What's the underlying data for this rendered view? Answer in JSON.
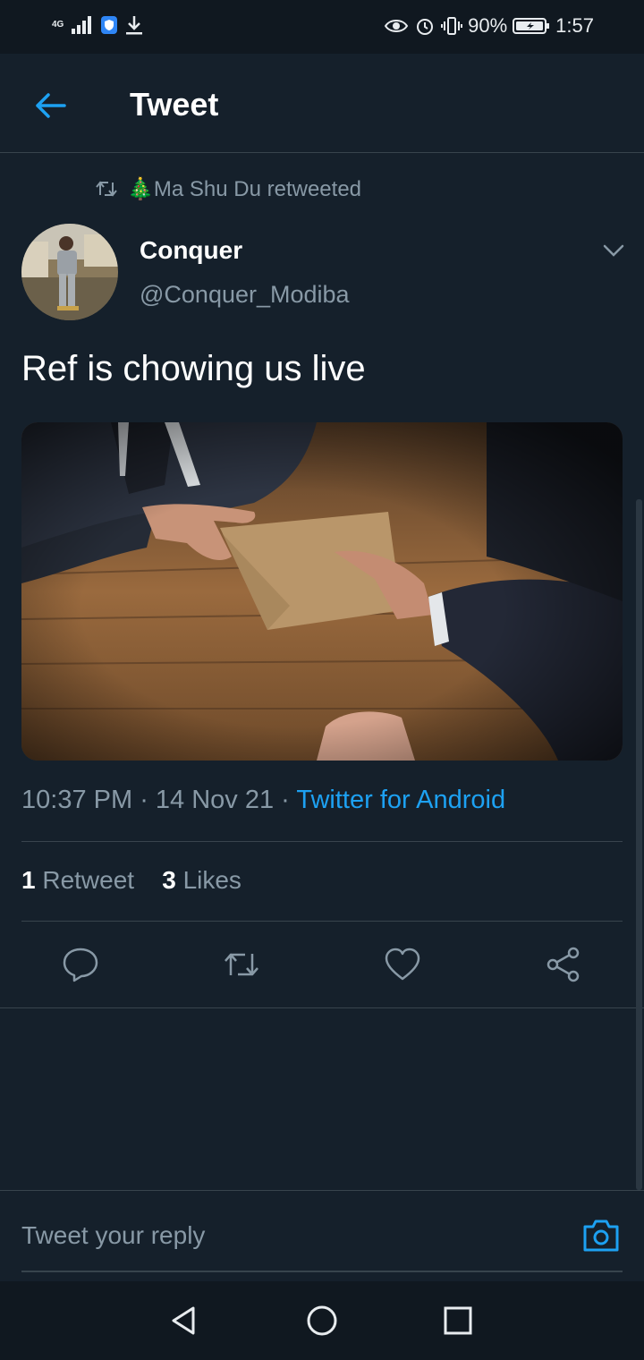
{
  "status_bar": {
    "network": "4G",
    "battery": "90%",
    "time": "1:57"
  },
  "header": {
    "title": "Tweet"
  },
  "retweet": {
    "emoji": "🎄",
    "text": "Ma Shu Du retweeted"
  },
  "tweet": {
    "display_name": "Conquer",
    "handle": "@Conquer_Modiba",
    "text": "Ref is chowing us live",
    "time": "10:37 PM",
    "date": "14 Nov 21",
    "source": "Twitter for Android",
    "separator": " · "
  },
  "stats": {
    "retweet_count": "1",
    "retweet_label": "Retweet",
    "like_count": "3",
    "like_label": "Likes"
  },
  "reply": {
    "placeholder": "Tweet your reply"
  },
  "colors": {
    "background": "#15202b",
    "accent": "#1da1f2",
    "secondary_text": "#8899a6",
    "divider": "#38444d"
  }
}
